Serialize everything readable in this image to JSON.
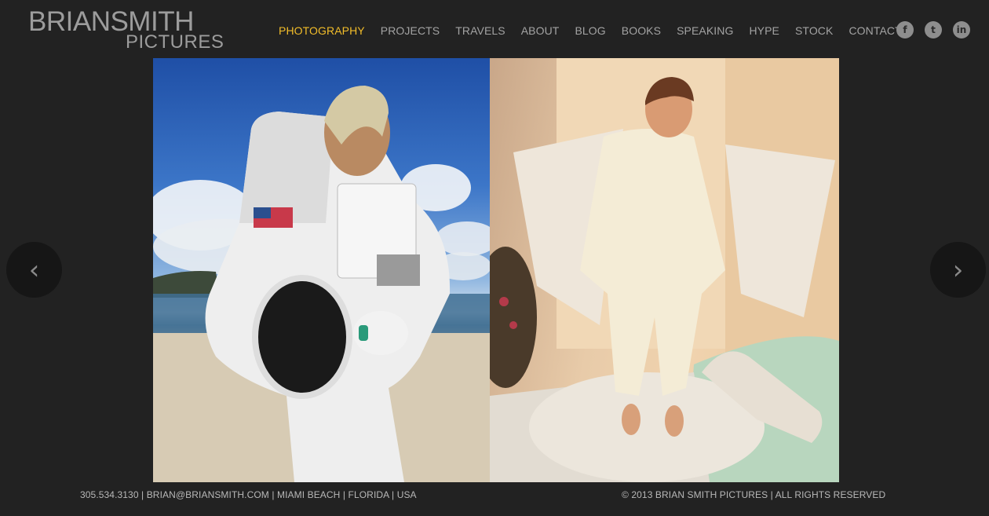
{
  "brand": {
    "line1": "BRIANSMITH",
    "line2": "PICTURES"
  },
  "nav": {
    "items": [
      {
        "label": "PHOTOGRAPHY",
        "active": true
      },
      {
        "label": "PROJECTS",
        "active": false
      },
      {
        "label": "TRAVELS",
        "active": false
      },
      {
        "label": "ABOUT",
        "active": false
      },
      {
        "label": "BLOG",
        "active": false
      },
      {
        "label": "BOOKS",
        "active": false
      },
      {
        "label": "SPEAKING",
        "active": false
      },
      {
        "label": "HYPE",
        "active": false
      },
      {
        "label": "STOCK",
        "active": false
      },
      {
        "label": "CONTACT",
        "active": false
      }
    ],
    "active_color": "#f2bd2a",
    "text_color": "#a3a3a3"
  },
  "social": {
    "items": [
      {
        "icon": "facebook-icon",
        "glyph": "f"
      },
      {
        "icon": "twitter-icon",
        "glyph": "t"
      },
      {
        "icon": "linkedin-icon",
        "glyph": "in"
      }
    ]
  },
  "slideshow": {
    "prev_glyph": "‹",
    "next_glyph": "›",
    "images": [
      {
        "subject": "man-in-spacesuit-on-beach"
      },
      {
        "subject": "man-in-white-suit-on-eagle-sculpture"
      }
    ]
  },
  "footer": {
    "phone": "305.534.3130",
    "email": "BRIAN@BRIANSMITH.COM",
    "city": "MIAMI BEACH",
    "state": "FLORIDA",
    "country": "USA",
    "separator": " | ",
    "copyright": "© 2013 BRIAN SMITH PICTURES | ALL RIGHTS RESERVED"
  },
  "colors": {
    "background": "#222222",
    "accent": "#f2bd2a"
  }
}
